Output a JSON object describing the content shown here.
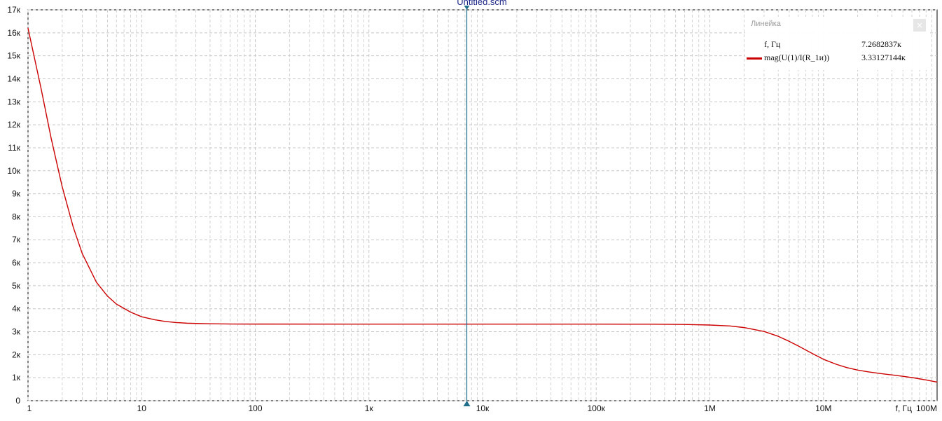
{
  "window": {
    "title": "Untitled.scm"
  },
  "colors": {
    "curve": "#cc0000",
    "cursor": "#1f6f8b",
    "grid": "#c8c8c8",
    "axis": "#000000",
    "title": "#1f2a8a"
  },
  "ruler": {
    "title": "Линейка",
    "close_icon": "close-icon",
    "x_label": "f, Гц",
    "x_value": "7.2682837к",
    "series_label": "mag(U(1)/I(R_1и))",
    "series_value": "3.33127144к"
  },
  "chart_data": {
    "type": "line",
    "x_scale": "log",
    "x_axis_label": "f, Гц",
    "xlim": [
      1,
      100000000
    ],
    "ylim": [
      0,
      17000
    ],
    "grid": true,
    "x_ticks": [
      {
        "value": 1,
        "label": "1"
      },
      {
        "value": 10,
        "label": "10"
      },
      {
        "value": 100,
        "label": "100"
      },
      {
        "value": 1000,
        "label": "1к"
      },
      {
        "value": 10000,
        "label": "10к"
      },
      {
        "value": 100000,
        "label": "100к"
      },
      {
        "value": 1000000,
        "label": "1M"
      },
      {
        "value": 10000000,
        "label": "10M"
      },
      {
        "value": 100000000,
        "label": "100M"
      }
    ],
    "y_ticks": [
      {
        "value": 0,
        "label": "0"
      },
      {
        "value": 1000,
        "label": "1к"
      },
      {
        "value": 2000,
        "label": "2к"
      },
      {
        "value": 3000,
        "label": "3к"
      },
      {
        "value": 4000,
        "label": "4к"
      },
      {
        "value": 5000,
        "label": "5к"
      },
      {
        "value": 6000,
        "label": "6к"
      },
      {
        "value": 7000,
        "label": "7к"
      },
      {
        "value": 8000,
        "label": "8к"
      },
      {
        "value": 9000,
        "label": "9к"
      },
      {
        "value": 10000,
        "label": "10к"
      },
      {
        "value": 11000,
        "label": "11к"
      },
      {
        "value": 12000,
        "label": "12к"
      },
      {
        "value": 13000,
        "label": "13к"
      },
      {
        "value": 14000,
        "label": "14к"
      },
      {
        "value": 15000,
        "label": "15к"
      },
      {
        "value": 16000,
        "label": "16к"
      },
      {
        "value": 17000,
        "label": "17к"
      }
    ],
    "cursor_x": 7268.2837,
    "series": [
      {
        "name": "mag(U(1)/I(R_1и))",
        "color": "#cc0000",
        "points": [
          [
            1,
            16200
          ],
          [
            1.3,
            13600
          ],
          [
            1.6,
            11400
          ],
          [
            2,
            9300
          ],
          [
            2.5,
            7550
          ],
          [
            3,
            6400
          ],
          [
            4,
            5150
          ],
          [
            5,
            4550
          ],
          [
            6,
            4200
          ],
          [
            8,
            3850
          ],
          [
            10,
            3650
          ],
          [
            13,
            3520
          ],
          [
            16,
            3450
          ],
          [
            20,
            3400
          ],
          [
            25,
            3370
          ],
          [
            32,
            3355
          ],
          [
            40,
            3345
          ],
          [
            63,
            3335
          ],
          [
            100,
            3332
          ],
          [
            1000,
            3331
          ],
          [
            10000,
            3331
          ],
          [
            100000,
            3330
          ],
          [
            300000,
            3325
          ],
          [
            600000,
            3315
          ],
          [
            1000000,
            3290
          ],
          [
            1500000,
            3250
          ],
          [
            2000000,
            3180
          ],
          [
            3000000,
            3010
          ],
          [
            4000000,
            2800
          ],
          [
            5000000,
            2580
          ],
          [
            6000000,
            2380
          ],
          [
            8000000,
            2050
          ],
          [
            10000000,
            1800
          ],
          [
            13000000,
            1580
          ],
          [
            16000000,
            1440
          ],
          [
            20000000,
            1330
          ],
          [
            25000000,
            1250
          ],
          [
            32000000,
            1180
          ],
          [
            40000000,
            1120
          ],
          [
            50000000,
            1060
          ],
          [
            63000000,
            990
          ],
          [
            80000000,
            900
          ],
          [
            100000000,
            810
          ]
        ]
      }
    ]
  }
}
